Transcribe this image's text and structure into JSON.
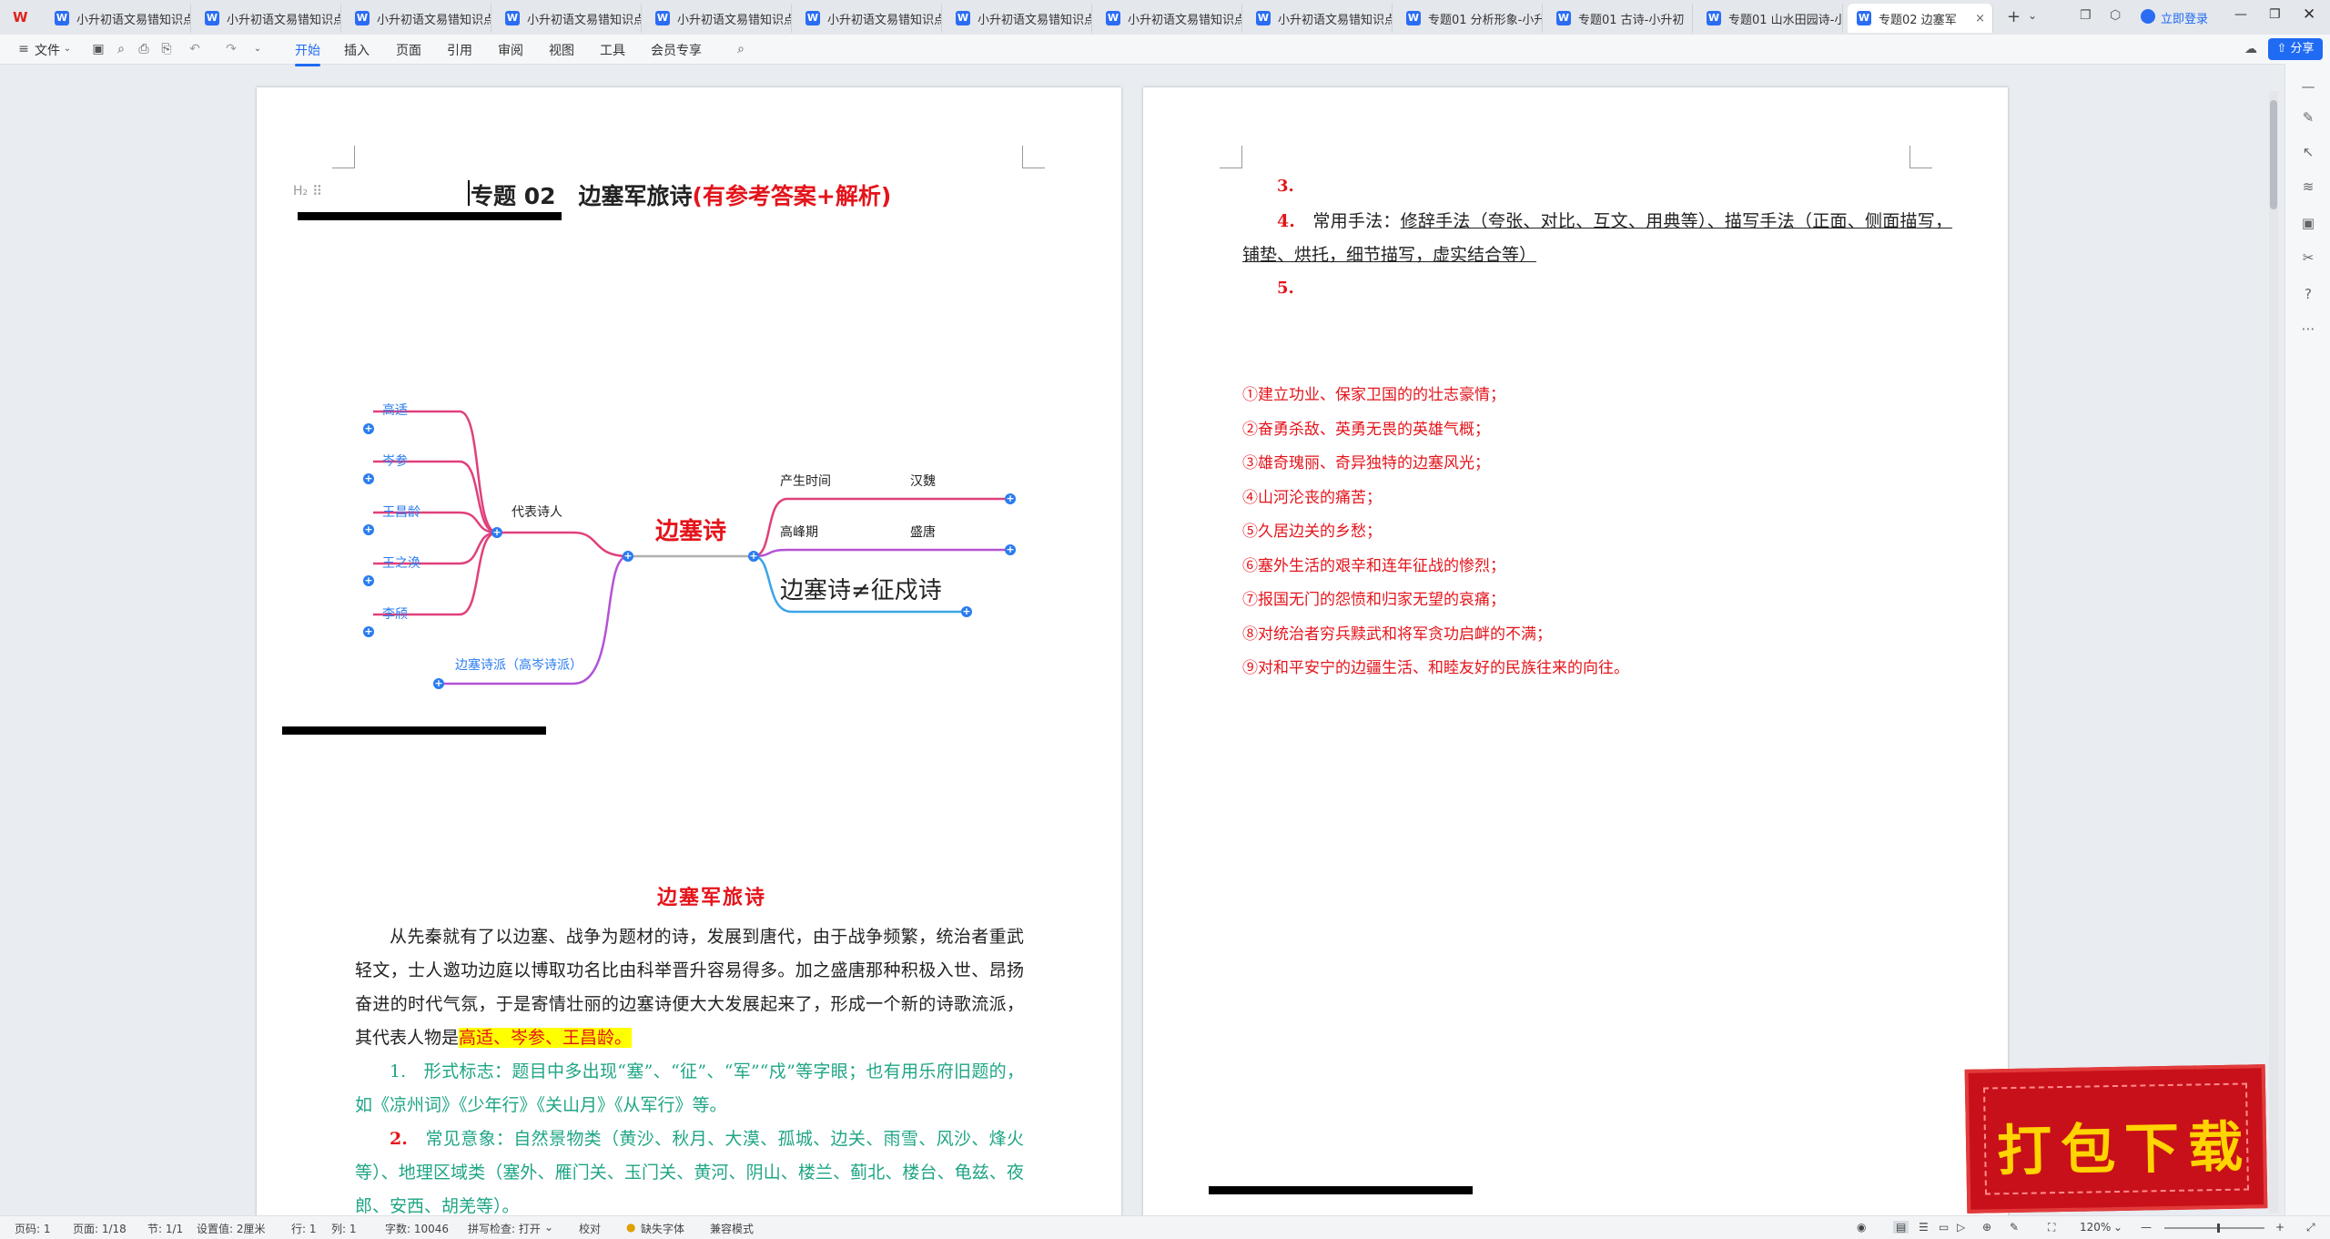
{
  "tabs": [
    {
      "label": "小升初语文易错知识点"
    },
    {
      "label": "小升初语文易错知识点"
    },
    {
      "label": "小升初语文易错知识点"
    },
    {
      "label": "小升初语文易错知识点"
    },
    {
      "label": "小升初语文易错知识点"
    },
    {
      "label": "小升初语文易错知识点"
    },
    {
      "label": "小升初语文易错知识点"
    },
    {
      "label": "小升初语文易错知识点"
    },
    {
      "label": "小升初语文易错知识点"
    },
    {
      "label": "专题01 分析形象-小升"
    },
    {
      "label": "专题01 古诗-小升初"
    },
    {
      "label": "专题01 山水田园诗-小"
    },
    {
      "label": "专题02 边塞军"
    }
  ],
  "window": {
    "login": "立即登录"
  },
  "ribbon": {
    "file": "文件",
    "menus": [
      "开始",
      "插入",
      "页面",
      "引用",
      "审阅",
      "视图",
      "工具",
      "会员专享"
    ],
    "share": "分享"
  },
  "page1": {
    "heading_marker": "H₂",
    "title_main": "专题 02　边塞军旅诗",
    "title_red": "(有参考答案+解析)",
    "mindmap": {
      "center": "边塞诗",
      "poets_label": "代表诗人",
      "poets": [
        "高适",
        "岑参",
        "王昌龄",
        "王之涣",
        "李颀"
      ],
      "school": "边塞诗派（高岑诗派）",
      "time_label": "产生时间",
      "time_value": "汉魏",
      "peak_label": "高峰期",
      "peak_value": "盛唐",
      "note": "边塞诗≠征戍诗"
    },
    "section_title": "边塞军旅诗",
    "intro": "从先秦就有了以边塞、战争为题材的诗，发展到唐代，由于战争频繁，统治者重武轻文，士人邀功边庭以博取功名比由科举晋升容易得多。加之盛唐那种积极入世、昂扬奋进的时代气氛，于是寄情壮丽的边塞诗便大大发展起来了，形成一个新的诗歌流派，其代表人物是",
    "intro_hl": "高适、岑参、王昌龄。",
    "item1_num": "1.",
    "item1": "形式标志：题目中多出现“塞”、“征”、“军”“戍”等字眼；也有用乐府旧题的，如《凉州词》《少年行》《关山月》《从军行》等。",
    "item2_num": "2.",
    "item2": "常见意象：自然景物类（黄沙、秋月、大漠、孤城、边关、雨雪、风沙、烽火等）、地理区域类（塞外、雁门关、玉门关、黄河、阴山、楼兰、蓟北、楼台、龟兹、夜郎、安西、胡羌等）。"
  },
  "page2": {
    "n3": "3.",
    "n4": "4.",
    "item4_label": "常用手法：",
    "item4_text": "修辞手法（夸张、对比、互文、用典等）、描写手法（正面、侧面描写，铺垫、烘托，细节描写，虚实结合等）",
    "n5": "5.",
    "themes": [
      "①建立功业、保家卫国的的壮志豪情；",
      "②奋勇杀敌、英勇无畏的英雄气概；",
      "③雄奇瑰丽、奇异独特的边塞风光；",
      "④山河沦丧的痛苦；",
      "⑤久居边关的乡愁；",
      "⑥塞外生活的艰辛和连年征战的惨烈；",
      "⑦报国无门的怨愤和归家无望的哀痛；",
      "⑧对统治者穷兵黩武和将军贪功启衅的不满；",
      "⑨对和平安宁的边疆生活、和睦友好的民族往来的向往。"
    ]
  },
  "badge": {
    "text": "打包下载"
  },
  "status": {
    "page": "页码: 1",
    "pages": "页面: 1/18",
    "section": "节: 1/1",
    "setting": "设置值: 2厘米",
    "row": "行: 1",
    "col": "列: 1",
    "words": "字数: 10046",
    "spell": "拼写检查: 打开",
    "proof": "校对",
    "font_missing": "缺失字体",
    "compat": "兼容模式",
    "zoom": "120%"
  },
  "colors": {
    "accent": "#1f6bf3",
    "red": "#e4141b",
    "green": "#1fa585",
    "highlight": "#ffff00",
    "badge_bg": "#c8101a",
    "badge_text": "#ffd400"
  }
}
